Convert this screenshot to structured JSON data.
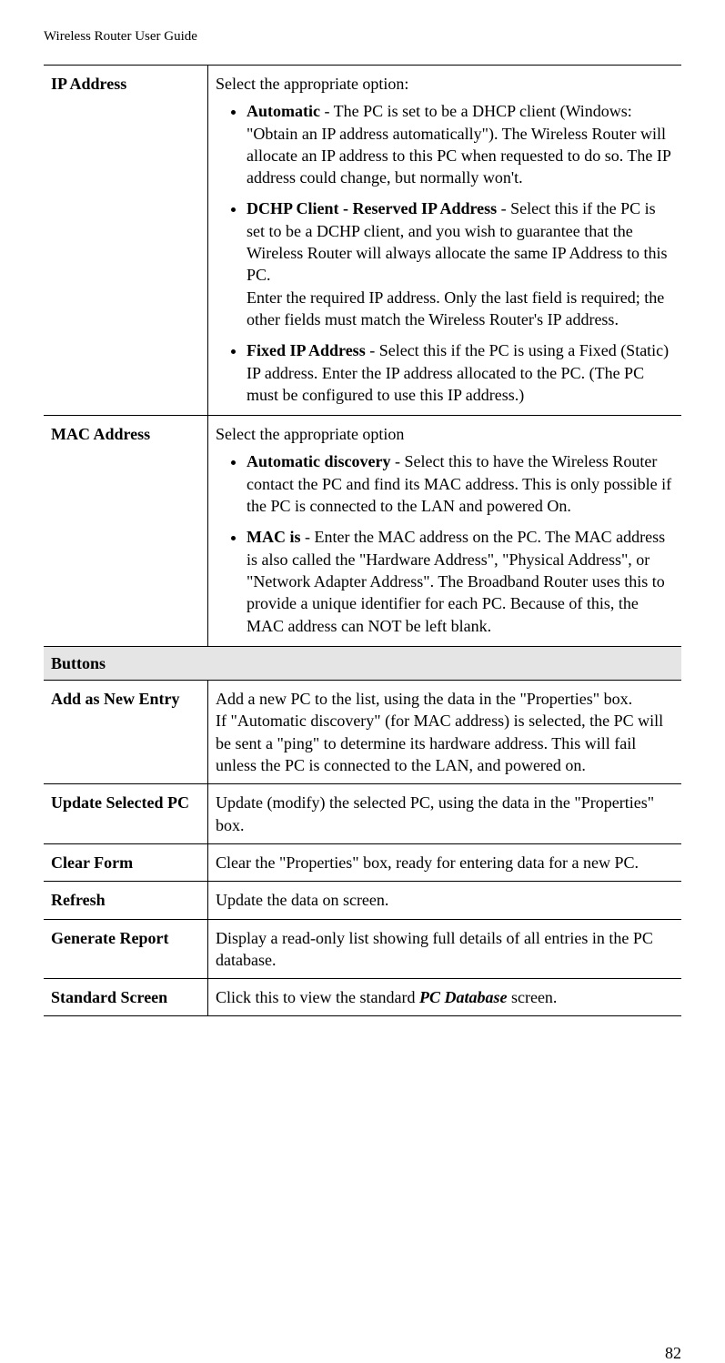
{
  "header": "Wireless Router User Guide",
  "page_number": "82",
  "rows": {
    "ip_address": {
      "label": "IP Address",
      "intro": "Select the appropriate option:",
      "opt1_name": "Automatic",
      "opt1_text": " - The PC is set to be a DHCP client (Windows: \"Obtain an IP address automatically\"). The Wireless Router will allocate an IP address to this PC when requested to do so. The IP address could change, but normally won't.",
      "opt2_name": "DCHP Client - Reserved IP Address",
      "opt2_text": " - Select this if the PC is set to be a DCHP client, and you wish to guarantee that the Wireless Router will always allocate the same IP Address to this PC.",
      "opt2_text2": "Enter the required IP address. Only the last field is required; the other fields must match the Wireless Router's IP address.",
      "opt3_name": "Fixed IP Address",
      "opt3_text": " - Select this if the PC is using a Fixed (Static) IP address. Enter the IP address allocated to the PC. (The PC must be configured to use this IP address.)"
    },
    "mac_address": {
      "label": "MAC Address",
      "intro": "Select the appropriate option",
      "opt1_name": "Automatic discovery",
      "opt1_text": " - Select this to have the Wireless Router contact the PC and find its MAC address. This is only possible if the PC is connected to the LAN and powered On.",
      "opt2_name": "MAC is",
      "opt2_text": " - Enter the MAC address on the PC. The MAC address is also called the \"Hardware Address\", \"Physical Address\", or \"Network Adapter Address\". The Broadband Router uses this to provide a unique identifier for each PC. Because of this, the MAC address can NOT be left blank."
    },
    "section_buttons": "Buttons",
    "add_new": {
      "label": "Add as New Entry",
      "text1": "Add a new PC to the list, using the data in the \"Properties\" box.",
      "text2": "If \"Automatic discovery\" (for MAC address) is selected, the PC will be sent a \"ping\" to determine its hardware address. This will fail unless the PC is connected to the LAN, and powered on."
    },
    "update_selected": {
      "label": "Update Selected PC",
      "text": "Update (modify) the selected PC, using the data in the \"Properties\" box."
    },
    "clear_form": {
      "label": "Clear Form",
      "text": "Clear the \"Properties\" box, ready for entering data for a new PC."
    },
    "refresh": {
      "label": "Refresh",
      "text": "Update the data on screen."
    },
    "generate_report": {
      "label": "Generate Report",
      "text": "Display a read-only list showing full details of all entries in the PC database."
    },
    "standard_screen": {
      "label": "Standard Screen",
      "text_before": "Click this to view the standard ",
      "text_em": "PC Database",
      "text_after": " screen."
    }
  }
}
